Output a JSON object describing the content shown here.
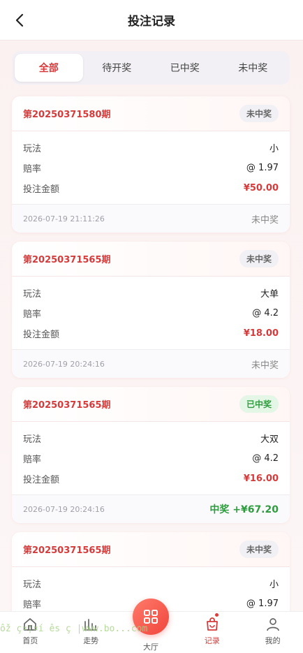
{
  "header": {
    "title": "投注记录"
  },
  "tabs": [
    {
      "label": "全部",
      "active": true
    },
    {
      "label": "待开奖",
      "active": false
    },
    {
      "label": "已中奖",
      "active": false
    },
    {
      "label": "未中奖",
      "active": false
    }
  ],
  "labels": {
    "play": "玩法",
    "odds": "赔率",
    "amount": "投注金额"
  },
  "cards": [
    {
      "period": "第20250371580期",
      "status": "未中奖",
      "play": "小",
      "odds": "@ 1.97",
      "amount": "¥50.00",
      "time": "2026-07-19 21:11:26",
      "result": "未中奖"
    },
    {
      "period": "第20250371565期",
      "status": "未中奖",
      "play": "大单",
      "odds": "@ 4.2",
      "amount": "¥18.00",
      "time": "2026-07-19 20:24:16",
      "result": "未中奖"
    },
    {
      "period": "第20250371565期",
      "status": "已中奖",
      "play": "大双",
      "odds": "@ 4.2",
      "amount": "¥16.00",
      "time": "2026-07-19 20:24:16",
      "result": "中奖 +¥67.20"
    },
    {
      "period": "第20250371565期",
      "status": "未中奖",
      "play": "小",
      "odds": "@ 1.97",
      "amount": "",
      "time": "",
      "result": ""
    }
  ],
  "nav": {
    "home": "首页",
    "trend": "走势",
    "hall": "大厅",
    "records": "记录",
    "mine": "我的"
  },
  "watermark": "ôž ç¤¦¤í  ês  ç  |www.bo...com",
  "colors": {
    "accent": "#d63a3a",
    "win": "#2e9c3f",
    "center_button": "#f0453c"
  }
}
